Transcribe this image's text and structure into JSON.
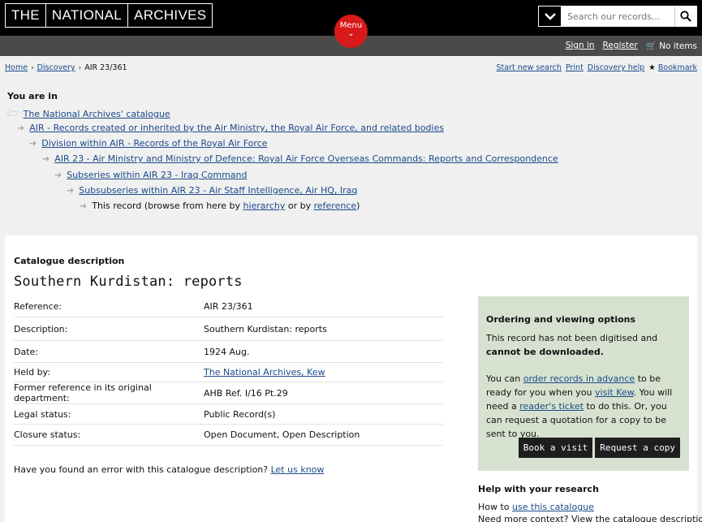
{
  "header": {
    "logo": [
      "THE",
      "NATIONAL",
      "ARCHIVES"
    ],
    "menu_label": "Menu",
    "search_placeholder": "Search our records...",
    "account": {
      "sign_in": "Sign in",
      "register": "Register",
      "basket": "No items"
    }
  },
  "breadcrumb": {
    "home": "Home",
    "discovery": "Discovery",
    "current": "AIR 23/361"
  },
  "tools": {
    "new_search": "Start new search",
    "print": "Print",
    "help": "Discovery help",
    "bookmark": "Bookmark"
  },
  "hierarchy": {
    "heading": "You are in",
    "levels": [
      "The National Archives' catalogue",
      "AIR - Records created or inherited by the Air Ministry, the Royal Air Force, and related bodies",
      "Division within AIR - Records of the Royal Air Force",
      "AIR 23 - Air Ministry and Ministry of Defence: Royal Air Force Overseas Commands: Reports and Correspondence",
      "Subseries within AIR 23 - Iraq Command",
      "Subsubseries within AIR 23 - Air Staff Intelligence, Air HQ, Iraq"
    ],
    "this_record_prefix": "This record (browse from here by",
    "hierarchy_link": "hierarchy",
    "or_by": "or by",
    "reference_link": "reference",
    "close_paren": ")"
  },
  "record": {
    "section_label": "Catalogue description",
    "title": "Southern Kurdistan: reports",
    "details": [
      {
        "label": "Reference:",
        "value": "AIR 23/361"
      },
      {
        "label": "Description:",
        "value": "Southern Kurdistan: reports"
      },
      {
        "label": "Date:",
        "value": "1924 Aug."
      },
      {
        "label": "Held by:",
        "value": "The National Archives, Kew"
      },
      {
        "label": "Former reference in its original department:",
        "value": "AHB Ref. I/16 Pt.29"
      },
      {
        "label": "Legal status:",
        "value": "Public Record(s)"
      },
      {
        "label": "Closure status:",
        "value": "Open Document, Open Description"
      }
    ],
    "error_prompt": "Have you found an error with this catalogue description?",
    "error_link": "Let us know"
  },
  "ordering": {
    "heading": "Ordering and viewing options",
    "status_text": "This record has not been digitised and",
    "status_bold": "cannot be downloaded.",
    "p2_a": "You can",
    "p2_link1": "order records in advance",
    "p2_b": "to be ready for you when you",
    "p2_link2": "visit Kew",
    "p2_c": ". You will need a",
    "p2_link3": "reader's ticket",
    "p2_d": "to do this. Or, you can request a quotation for a copy to be sent to you.",
    "book_visit": "Book a visit",
    "request_copy": "Request a copy"
  },
  "help": {
    "heading": "Help with your research",
    "how_to": "How to",
    "use_catalogue": "use this catalogue",
    "more_context": "Need more context? View the catalogue description"
  }
}
